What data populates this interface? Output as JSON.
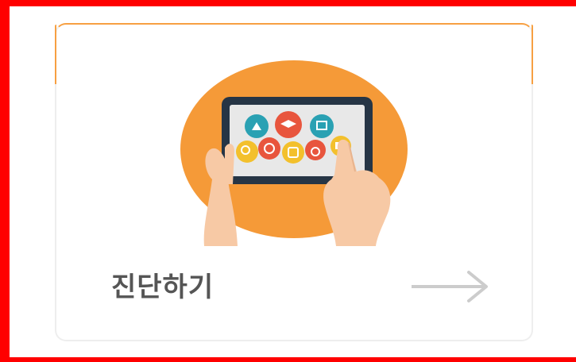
{
  "card": {
    "label": "진단하기",
    "illustration_icon": "tablet-education-icon",
    "arrow_icon": "arrow-right-icon"
  },
  "colors": {
    "frame": "#ff0000",
    "accent": "#f7a042",
    "circle": "#f59a38",
    "label_text": "#555555",
    "arrow": "#cccccc"
  }
}
